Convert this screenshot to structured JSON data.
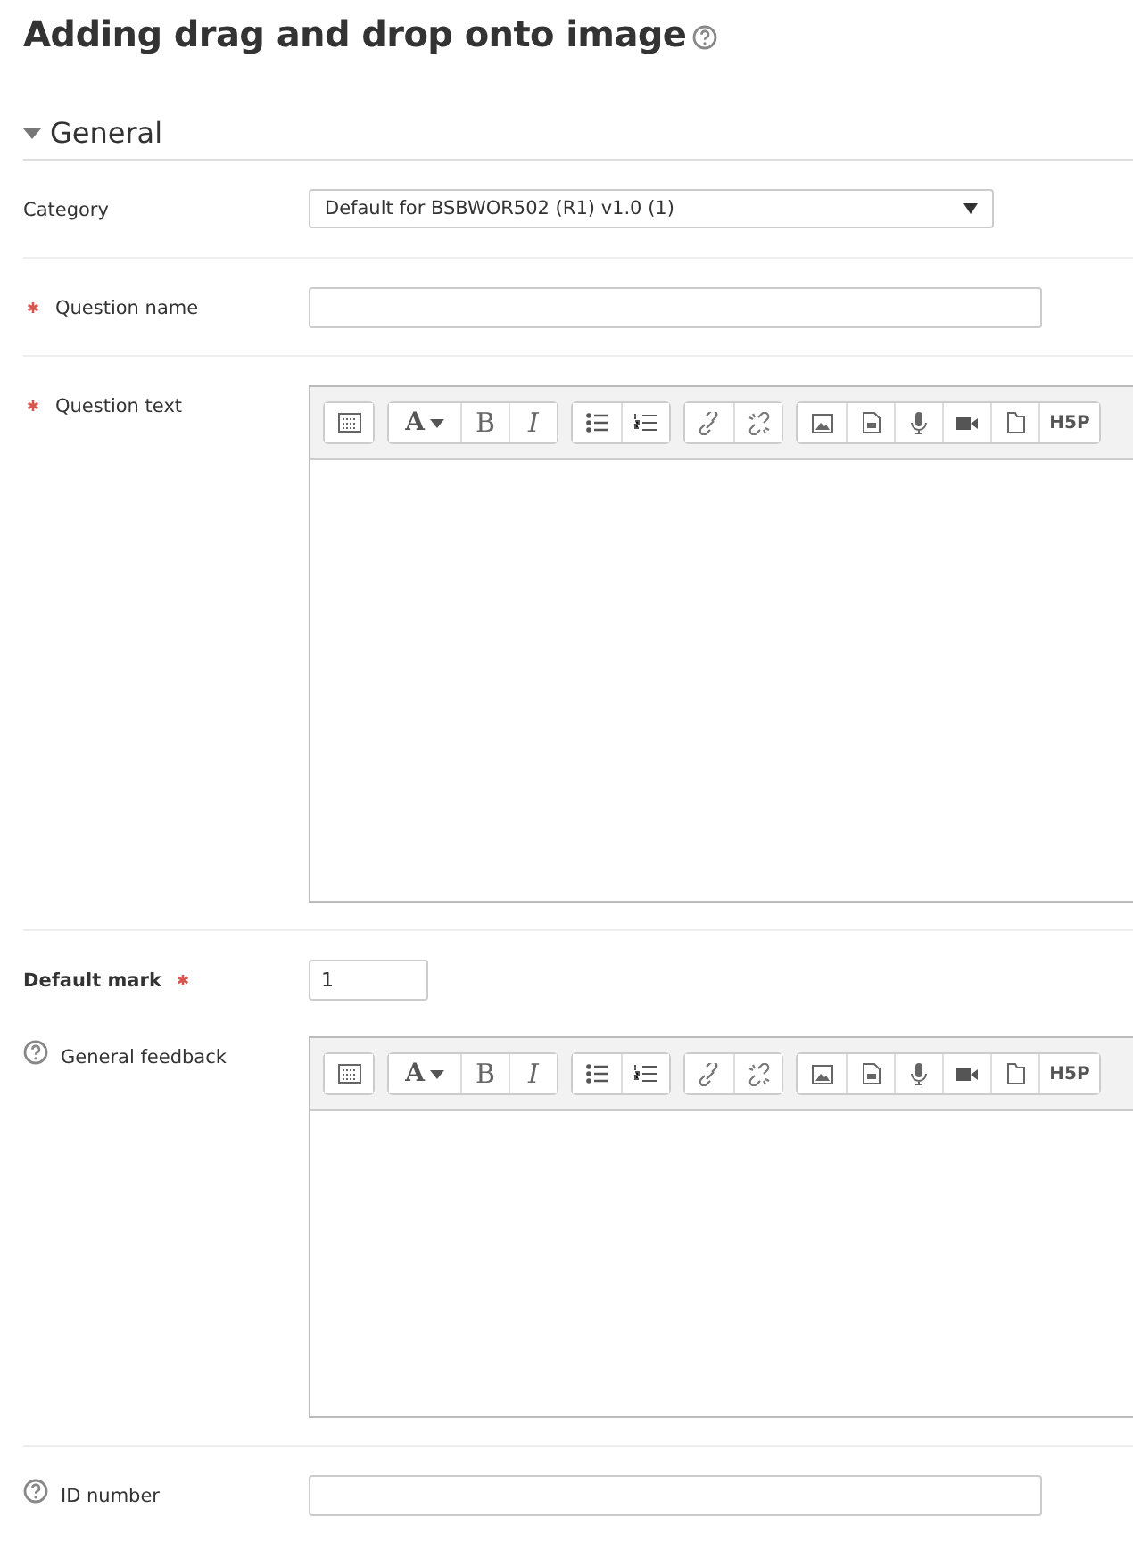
{
  "page_title": {
    "text": "Adding drag and drop onto image",
    "help": true
  },
  "section": {
    "title": "General",
    "expanded": true
  },
  "fields": [
    {
      "kind": "select",
      "label": "Category",
      "required": false,
      "help": false,
      "value": "Default for BSBWOR502 (R1) v1.0 (1)"
    },
    {
      "kind": "text",
      "label": "Question name",
      "required": true,
      "help": false
    },
    {
      "kind": "editor",
      "label": "Question text",
      "required": true,
      "help": false,
      "toolbar": [
        [
          {
            "kind": "toggle"
          }
        ],
        [
          {
            "kind": "font",
            "label": "A"
          },
          {
            "kind": "bold",
            "label": "B"
          },
          {
            "kind": "italic",
            "label": "I"
          }
        ],
        [
          {
            "kind": "ul"
          },
          {
            "kind": "ol"
          }
        ],
        [
          {
            "kind": "link"
          },
          {
            "kind": "unlink"
          }
        ],
        [
          {
            "kind": "image"
          },
          {
            "kind": "media"
          },
          {
            "kind": "audio"
          },
          {
            "kind": "video"
          },
          {
            "kind": "files"
          },
          {
            "kind": "h5p",
            "label": "H5P"
          }
        ]
      ]
    },
    {
      "kind": "number",
      "label": "Default mark",
      "required": true,
      "help": false,
      "bold": true,
      "value": "1"
    },
    {
      "kind": "editor",
      "label": "General feedback",
      "required": false,
      "help": true,
      "toolbar": [
        [
          {
            "kind": "toggle"
          }
        ],
        [
          {
            "kind": "font",
            "label": "A"
          },
          {
            "kind": "bold",
            "label": "B"
          },
          {
            "kind": "italic",
            "label": "I"
          }
        ],
        [
          {
            "kind": "ul"
          },
          {
            "kind": "ol"
          }
        ],
        [
          {
            "kind": "link"
          },
          {
            "kind": "unlink"
          }
        ],
        [
          {
            "kind": "image"
          },
          {
            "kind": "media"
          },
          {
            "kind": "audio"
          },
          {
            "kind": "video"
          },
          {
            "kind": "files"
          },
          {
            "kind": "h5p",
            "label": "H5P"
          }
        ]
      ]
    },
    {
      "kind": "text",
      "label": "ID number",
      "required": false,
      "help": true
    }
  ]
}
